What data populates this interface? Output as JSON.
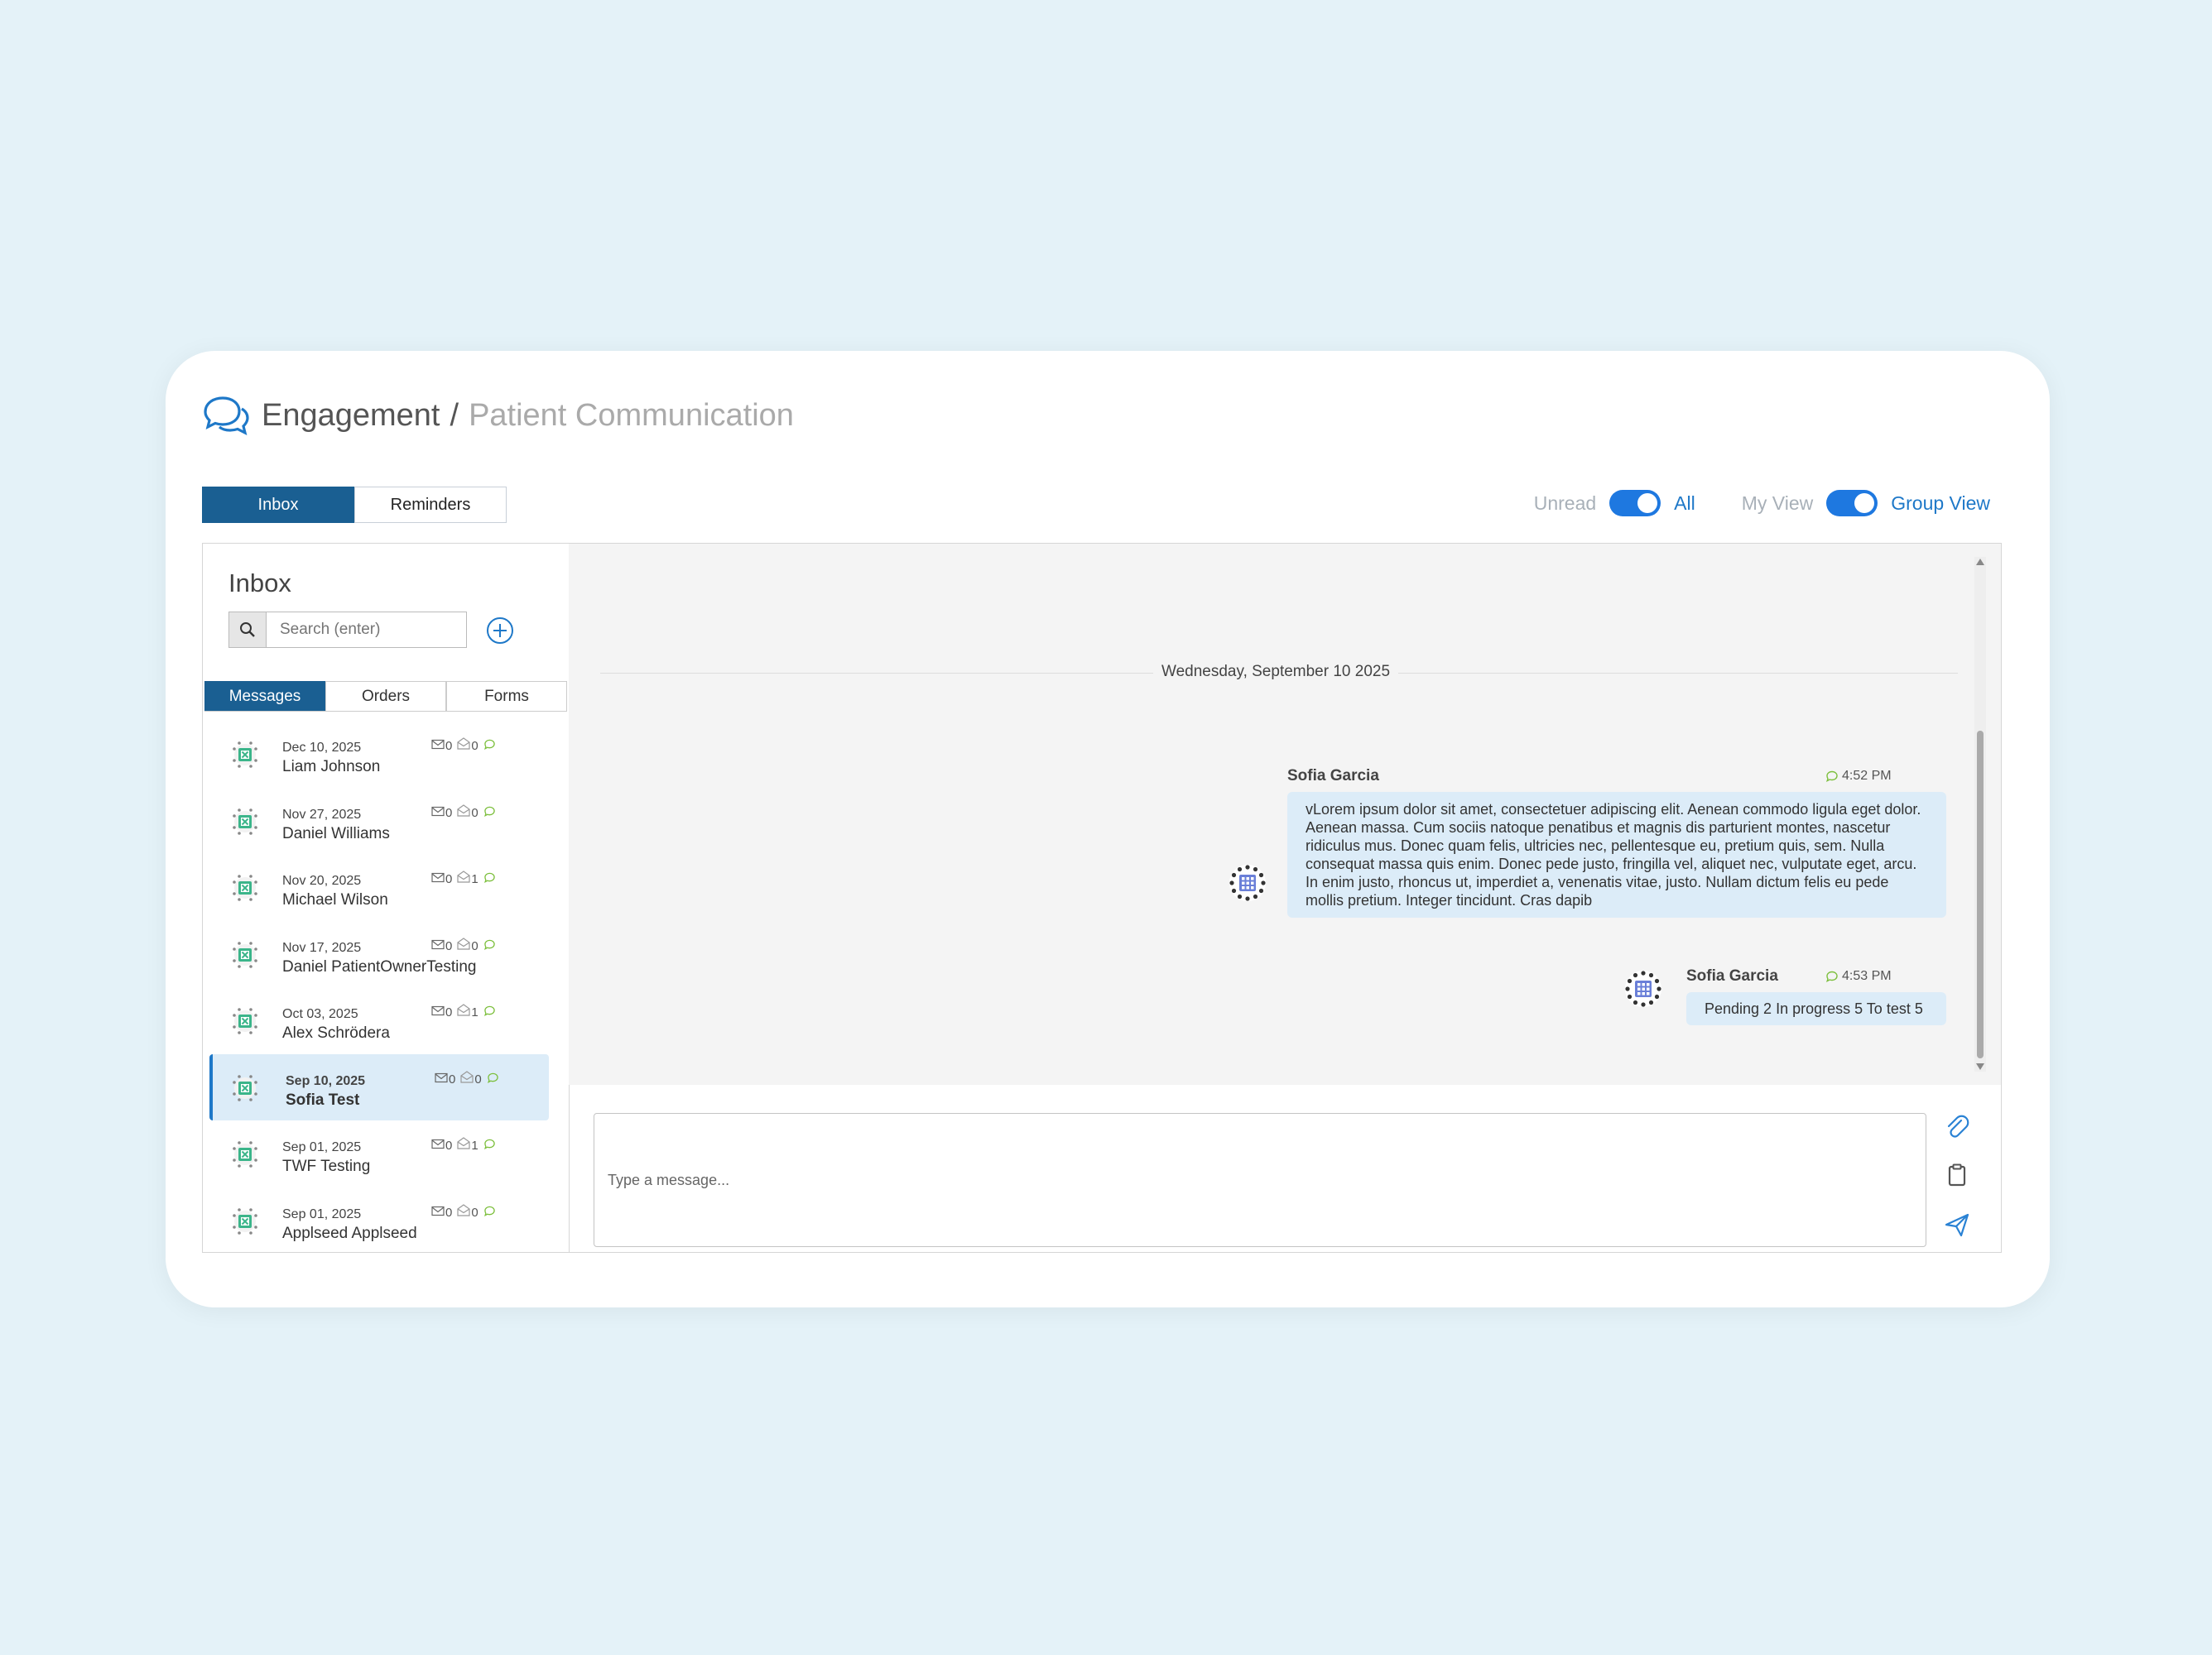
{
  "header": {
    "title": "Engagement",
    "separator": "/",
    "subtitle": "Patient Communication"
  },
  "top_tabs": [
    {
      "label": "Inbox",
      "active": true
    },
    {
      "label": "Reminders",
      "active": false
    }
  ],
  "toggles": {
    "filter": {
      "off_label": "Unread",
      "on_label": "All",
      "state": "All"
    },
    "view": {
      "off_label": "My View",
      "on_label": "Group View",
      "state": "Group View"
    }
  },
  "sidebar": {
    "title": "Inbox",
    "search_placeholder": "Search (enter)",
    "tabs": [
      {
        "label": "Messages",
        "active": true
      },
      {
        "label": "Orders",
        "active": false
      },
      {
        "label": "Forms",
        "active": false
      }
    ],
    "items": [
      {
        "date": "Dec 10, 2025",
        "name": "Liam Johnson",
        "mail": "0",
        "opened": "0",
        "selected": false
      },
      {
        "date": "Nov 27, 2025",
        "name": "Daniel Williams",
        "mail": "0",
        "opened": "0",
        "selected": false
      },
      {
        "date": "Nov 20, 2025",
        "name": "Michael Wilson",
        "mail": "0",
        "opened": "1",
        "selected": false
      },
      {
        "date": "Nov 17, 2025",
        "name": "Daniel PatientOwnerTesting",
        "mail": "0",
        "opened": "0",
        "selected": false
      },
      {
        "date": "Oct 03, 2025",
        "name": "Alex Schrödera",
        "mail": "0",
        "opened": "1",
        "selected": false
      },
      {
        "date": "Sep 10, 2025",
        "name": "Sofia Test",
        "mail": "0",
        "opened": "0",
        "selected": true
      },
      {
        "date": "Sep 01, 2025",
        "name": "TWF Testing",
        "mail": "0",
        "opened": "1",
        "selected": false
      },
      {
        "date": "Sep 01, 2025",
        "name": "Applseed Applseed",
        "mail": "0",
        "opened": "0",
        "selected": false
      }
    ]
  },
  "chat": {
    "date_divider": "Wednesday, September 10 2025",
    "messages": [
      {
        "sender": "Sofia Garcia",
        "time": "4:52 PM",
        "text": "vLorem ipsum dolor sit amet, consectetuer adipiscing elit. Aenean commodo ligula eget dolor. Aenean massa. Cum sociis natoque penatibus et magnis dis parturient montes, nascetur ridiculus mus. Donec quam felis, ultricies nec, pellentesque eu, pretium quis, sem. Nulla consequat massa quis enim. Donec pede justo, fringilla vel, aliquet nec, vulputate eget, arcu. In enim justo, rhoncus ut, imperdiet a, venenatis vitae, justo. Nullam dictum felis eu pede mollis pretium. Integer tincidunt. Cras dapib"
      },
      {
        "sender": "Sofia Garcia",
        "time": "4:53 PM",
        "text": "Pending 2 In progress 5 To test 5"
      }
    ]
  },
  "compose": {
    "placeholder": "Type a message..."
  },
  "colors": {
    "primary": "#1a5f92",
    "accent": "#1e78c8",
    "bubble": "#dcecf8",
    "background": "#e4f2f8"
  }
}
